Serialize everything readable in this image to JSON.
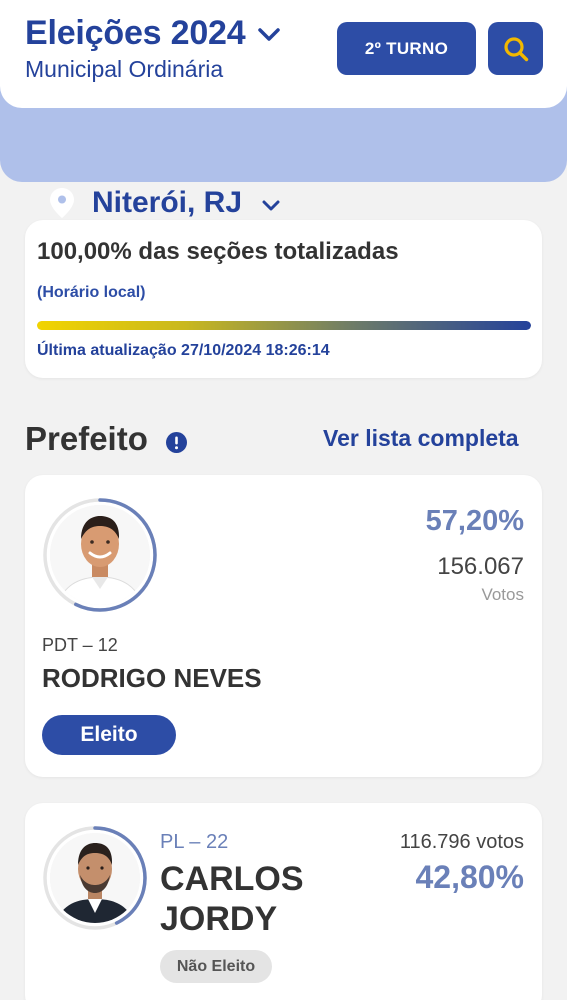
{
  "header": {
    "title": "Eleições 2024",
    "subtitle": "Municipal Ordinária",
    "turno_label": "2º TURNO",
    "search_icon": "search-icon"
  },
  "location": {
    "city": "Niterói, RJ",
    "icon": "location-pin-icon"
  },
  "status": {
    "title": "100,00% das seções totalizadas",
    "local_time_label": "(Horário local)",
    "progress_percent": 100,
    "updated": "Última atualização 27/10/2024 18:26:14"
  },
  "section": {
    "title": "Prefeito",
    "see_all_label": "Ver lista completa"
  },
  "candidates": [
    {
      "party": "PDT – 12",
      "name": "RODRIGO NEVES",
      "percent": "57,20%",
      "percent_value": 57.2,
      "votes": "156.067",
      "votes_label": "Votos",
      "status": "Eleito"
    },
    {
      "party": "PL – 22",
      "name_line1": "CARLOS",
      "name_line2": "JORDY",
      "percent": "42,80%",
      "percent_value": 42.8,
      "votes": "116.796 votos",
      "status": "Não Eleito"
    }
  ],
  "colors": {
    "primary": "#2d4da6",
    "title_blue": "#24429b",
    "location_band": "#afc0ea",
    "percent_text": "#6a80b8",
    "search_icon": "#f2b800"
  }
}
